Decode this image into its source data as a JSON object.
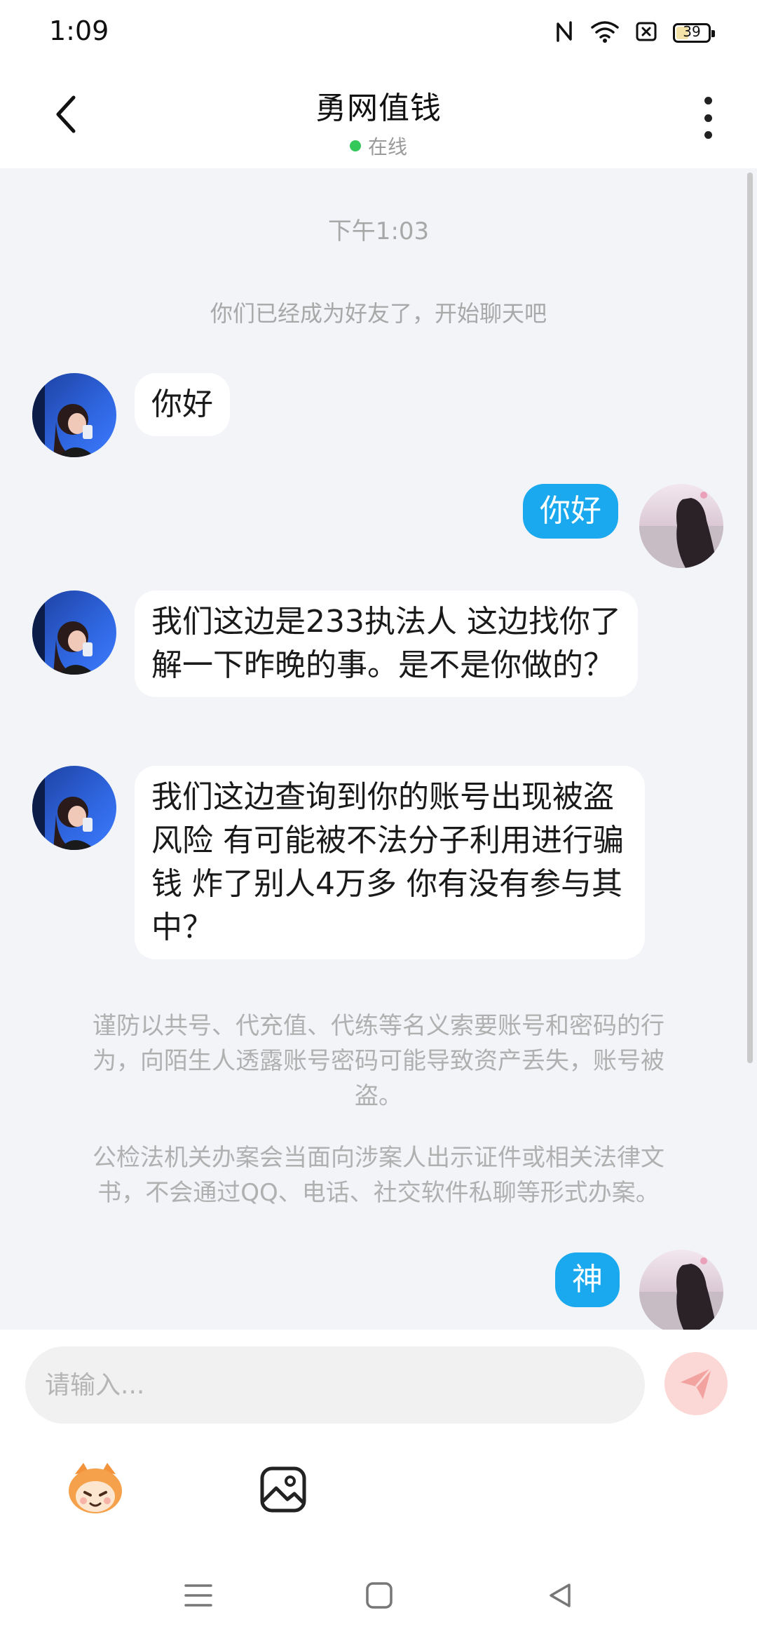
{
  "status_bar": {
    "time": "1:09",
    "battery": "39",
    "battery_level": 0.39,
    "icons": [
      "nfc-icon",
      "wifi-icon",
      "sim-off-icon",
      "battery-icon"
    ]
  },
  "header": {
    "title": "勇网值钱",
    "status": "在线",
    "status_color": "#34c85a",
    "back_icon": "chevron-left-icon",
    "more_icon": "more-vertical-icon"
  },
  "chat": {
    "timestamp": "下午1:03",
    "system_message": "你们已经成为好友了，开始聊天吧",
    "messages": [
      {
        "sender": "peer",
        "text": "你好"
      },
      {
        "sender": "self",
        "text": "你好"
      },
      {
        "sender": "peer",
        "text": "我们这边是233执法人 这边找你了解一下昨晚的事。是不是你做的？"
      },
      {
        "sender": "peer",
        "text": "我们这边查询到你的账号出现被盗风险 有可能被不法分子利用进行骗钱 炸了别人4万多 你有没有参与其中？"
      },
      {
        "sender": "self",
        "text": "神"
      }
    ],
    "notices": [
      "谨防以共号、代充值、代练等名义索要账号和密码的行为，向陌生人透露账号密码可能导致资产丢失，账号被盗。",
      "公检法机关办案会当面向涉案人出示证件或相关法律文书，不会通过QQ、电话、社交软件私聊等形式办案。"
    ],
    "self_bubble_color": "#1aa9ee",
    "background_color": "#f2f4f8"
  },
  "composer": {
    "placeholder": "请输入...",
    "send_icon": "paper-plane-icon",
    "tools": [
      "emoji-mascot-icon",
      "image-icon"
    ]
  },
  "nav_bar": {
    "buttons": [
      "menu-icon",
      "home-square-icon",
      "back-triangle-icon"
    ]
  }
}
